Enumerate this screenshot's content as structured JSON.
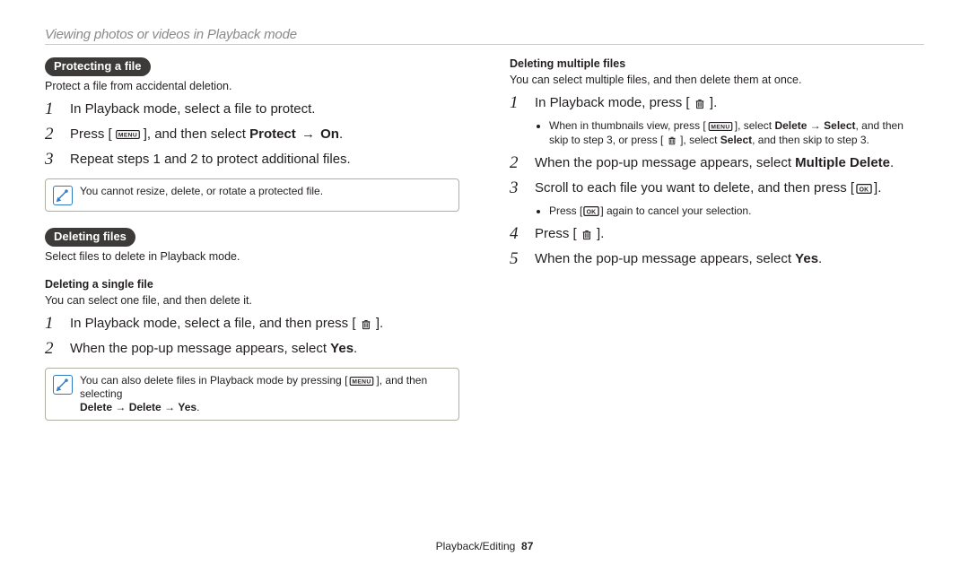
{
  "header_title": "Viewing photos or videos in Playback mode",
  "protecting": {
    "pill": "Protecting a file",
    "desc": "Protect a file from accidental deletion.",
    "step1": "In Playback mode, select a file to protect.",
    "step2_a": "Press [",
    "step2_b": "], and then select ",
    "protect": "Protect",
    "arrow": " → ",
    "on": "On",
    "step3": "Repeat steps 1 and 2 to protect additional files.",
    "note": "You cannot resize, delete, or rotate a protected file."
  },
  "deleting": {
    "pill": "Deleting files",
    "desc": "Select files to delete in Playback mode.",
    "single_head": "Deleting a single file",
    "single_desc": "You can select one file, and then delete it.",
    "s1_a": "In Playback mode, select a file, and then press [ ",
    "s1_b": " ].",
    "s2_a": "When the pop-up message appears, select ",
    "yes": "Yes",
    "note_a": "You can also delete files in Playback mode by pressing [",
    "note_b": "], and then selecting ",
    "note_chain1": "Delete",
    "note_chain2": " → ",
    "note_chain3": "Delete",
    "note_chain4": " → ",
    "note_chain5": "Yes"
  },
  "multi": {
    "head": "Deleting multiple files",
    "desc": "You can select multiple files, and then delete them at once.",
    "s1_a": "In Playback mode, press [ ",
    "s1_b": " ].",
    "s1b_a": "When in thumbnails view, press [",
    "s1b_b": "], select ",
    "delete": "Delete",
    "arrow": " → ",
    "select": "Select",
    "s1b_c": ", and then skip to step 3, or press [ ",
    "s1b_d": " ], select ",
    "s1b_e": ", and then skip to step 3.",
    "s2_a": "When the pop-up message appears, select ",
    "multiple_delete": "Multiple Delete",
    "s3_a": "Scroll to each file you want to delete, and then press [",
    "s3_b": "].",
    "s3b_a": "Press [",
    "s3b_b": "] again to cancel your selection.",
    "s4_a": "Press [ ",
    "s4_b": " ].",
    "s5_a": "When the pop-up message appears, select ",
    "yes": "Yes"
  },
  "footer_label": "Playback/Editing",
  "footer_page": "87",
  "step_nums": [
    "1",
    "2",
    "3",
    "4",
    "5"
  ]
}
